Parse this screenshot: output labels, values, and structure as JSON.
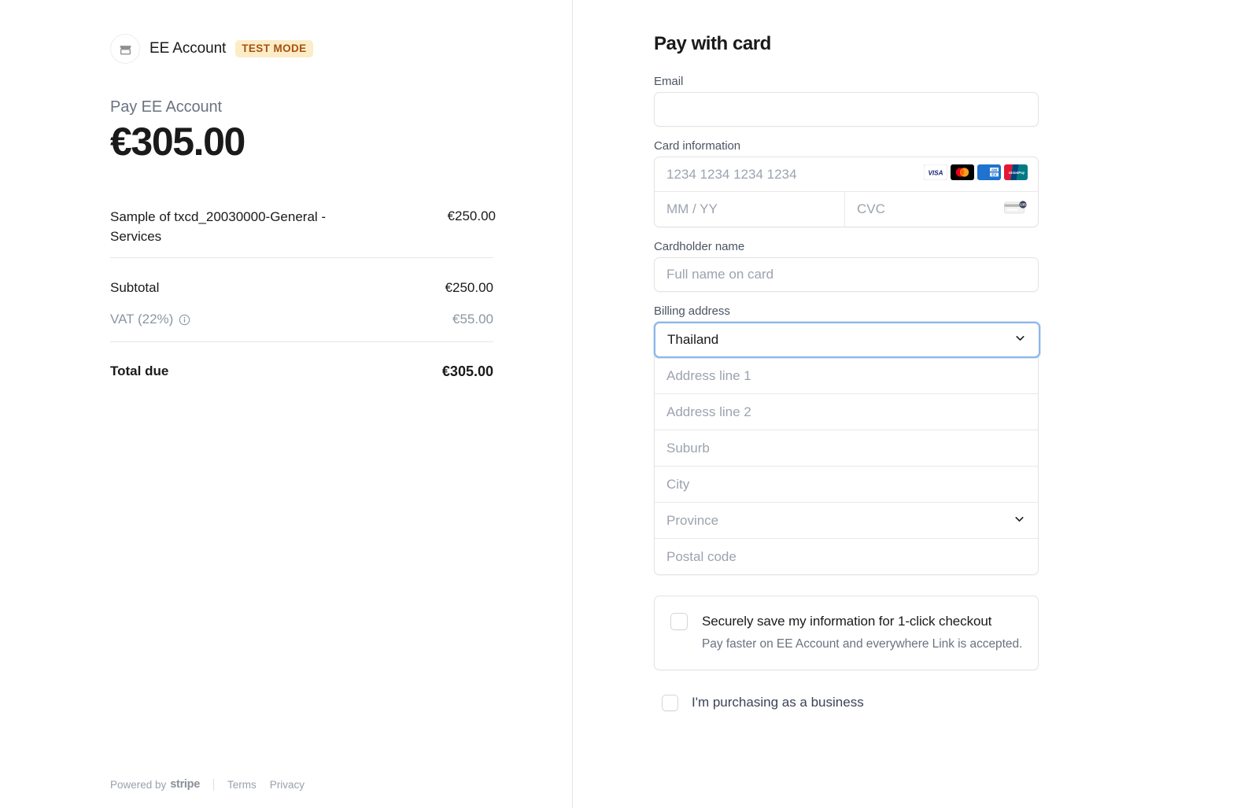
{
  "merchant": {
    "logo_icon": "storefront-icon",
    "name": "EE Account",
    "test_mode_badge": "TEST MODE"
  },
  "summary": {
    "pay_label": "Pay EE Account",
    "amount": "€305.00",
    "line_items": [
      {
        "name": "Sample of txcd_20030000-General - Services",
        "amount": "€250.00"
      }
    ],
    "subtotal_label": "Subtotal",
    "subtotal_amount": "€250.00",
    "vat_label": "VAT (22%)",
    "vat_info_icon": "info-circle-icon",
    "vat_amount": "€55.00",
    "total_label": "Total due",
    "total_amount": "€305.00"
  },
  "footer": {
    "powered_by": "Powered by",
    "stripe": "stripe",
    "terms": "Terms",
    "privacy": "Privacy"
  },
  "form": {
    "title": "Pay with card",
    "email": {
      "label": "Email",
      "value": "",
      "placeholder": ""
    },
    "card": {
      "label": "Card information",
      "number_placeholder": "1234 1234 1234 1234",
      "number_value": "",
      "expiry_placeholder": "MM / YY",
      "expiry_value": "",
      "cvc_placeholder": "CVC",
      "cvc_value": "",
      "cvc_hint_icon": "cvc-card-icon",
      "brands": [
        "visa-icon",
        "mastercard-icon",
        "amex-icon",
        "unionpay-icon"
      ]
    },
    "cardholder": {
      "label": "Cardholder name",
      "placeholder": "Full name on card",
      "value": ""
    },
    "billing": {
      "label": "Billing address",
      "country_value": "Thailand",
      "country_chevron_icon": "chevron-down-icon",
      "fields": [
        {
          "placeholder": "Address line 1",
          "value": "",
          "type": "text",
          "name": "address-line-1"
        },
        {
          "placeholder": "Address line 2",
          "value": "",
          "type": "text",
          "name": "address-line-2"
        },
        {
          "placeholder": "Suburb",
          "value": "",
          "type": "text",
          "name": "suburb"
        },
        {
          "placeholder": "City",
          "value": "",
          "type": "text",
          "name": "city"
        },
        {
          "placeholder": "Province",
          "value": "",
          "type": "select",
          "name": "province"
        },
        {
          "placeholder": "Postal code",
          "value": "",
          "type": "text",
          "name": "postal-code"
        }
      ]
    },
    "save_info": {
      "checked": false,
      "title": "Securely save my information for 1-click checkout",
      "subtitle": "Pay faster on EE Account and everywhere Link is accepted."
    },
    "business": {
      "checked": false,
      "label": "I'm purchasing as a business"
    }
  },
  "colors": {
    "test_mode_bg": "#fcedc8",
    "test_mode_text": "#a8500f",
    "focus_border": "#8ab7e8",
    "text_primary": "#1a1a1a",
    "text_muted": "#6b7280"
  }
}
